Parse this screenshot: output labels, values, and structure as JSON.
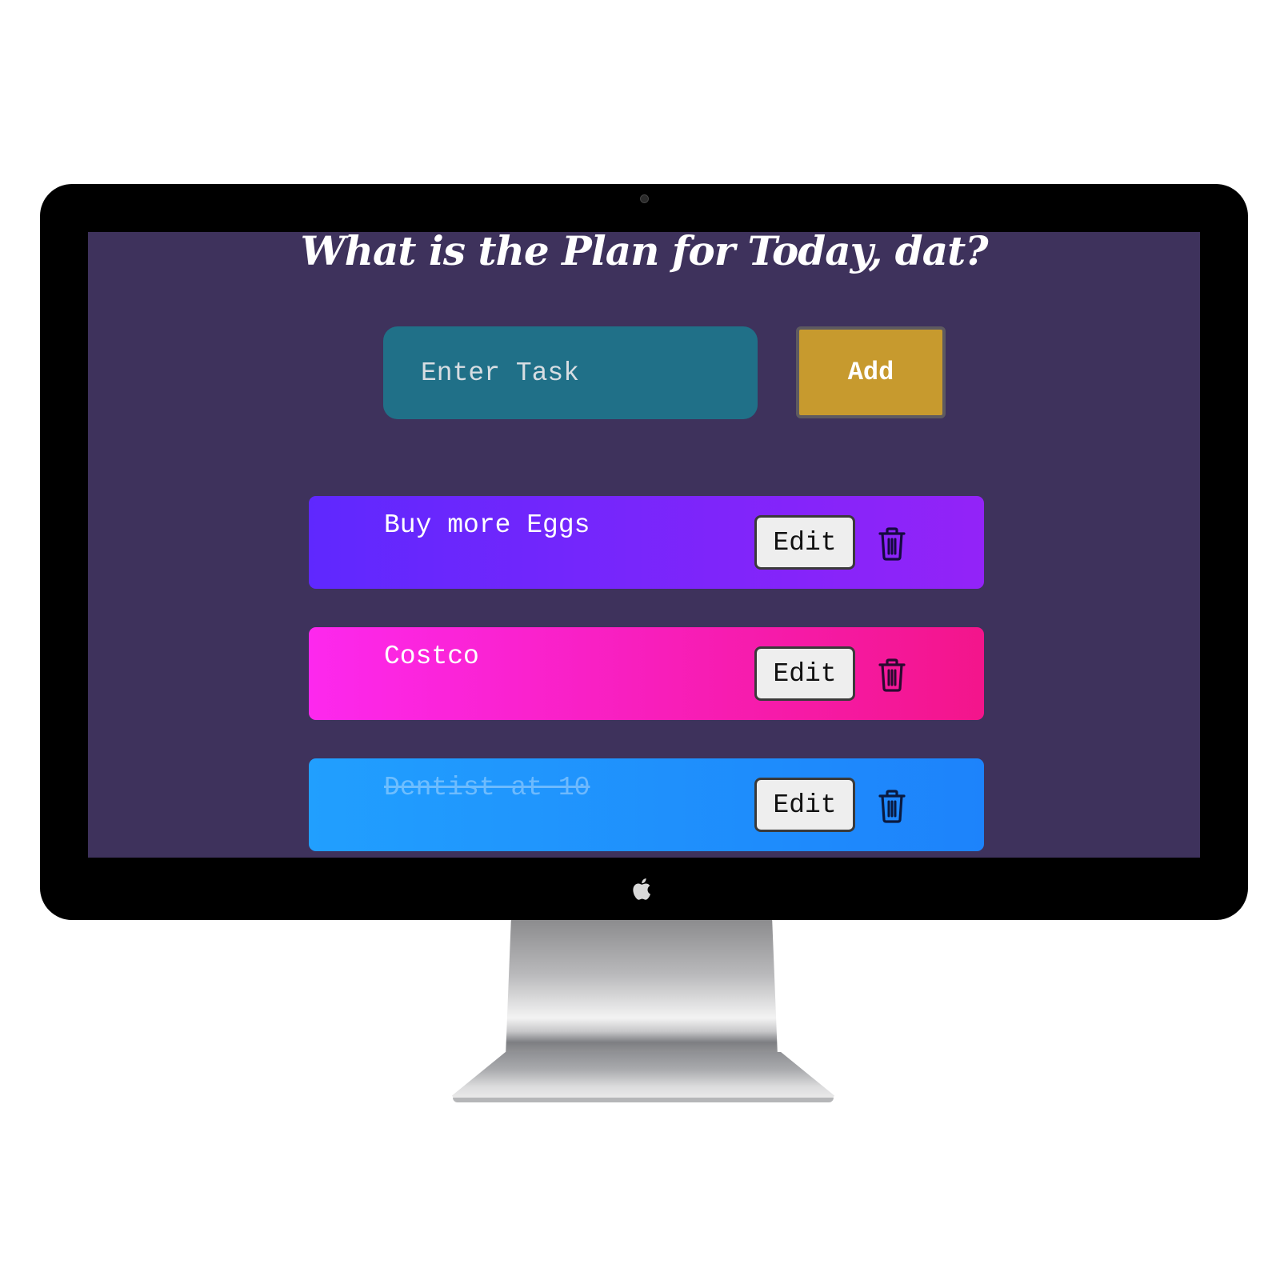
{
  "app": {
    "title": "What is the Plan for Today, dat?",
    "input_placeholder": "Enter Task",
    "input_value": "",
    "add_label": "Add",
    "colors": {
      "background": "#3e325c",
      "input": "#207088",
      "add_button": "#c79a2e"
    }
  },
  "todos": [
    {
      "text": "Buy more Eggs",
      "completed": false,
      "edit_label": "Edit",
      "delete_icon": "trash-icon",
      "gradient": [
        "#5f28fe",
        "#9323f8"
      ]
    },
    {
      "text": "Costco",
      "completed": false,
      "edit_label": "Edit",
      "delete_icon": "trash-icon",
      "gradient": [
        "#fd28ee",
        "#f3158b"
      ]
    },
    {
      "text": "Dentist at 10",
      "completed": true,
      "edit_label": "Edit",
      "delete_icon": "trash-icon",
      "gradient": [
        "#219ffe",
        "#1d83fb"
      ]
    }
  ]
}
